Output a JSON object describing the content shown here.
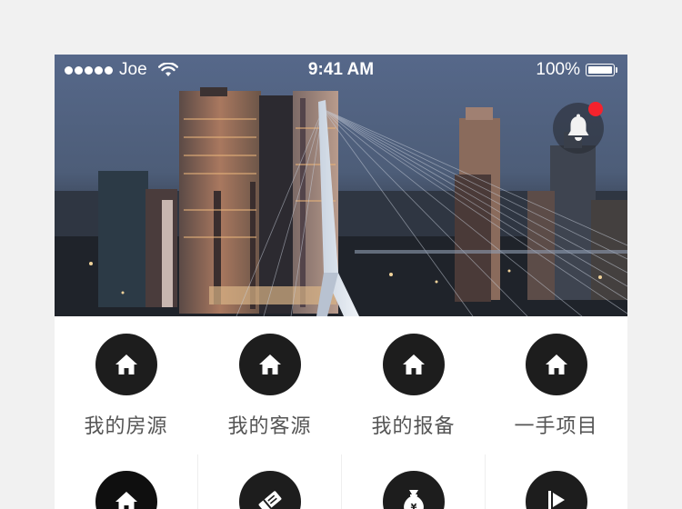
{
  "status_bar": {
    "carrier": "Joe",
    "time": "9:41 AM",
    "battery": "100%"
  },
  "notification": {
    "icon": "bell-icon",
    "has_unread": true,
    "badge_color": "#f5222d"
  },
  "grid": {
    "row1": [
      {
        "label": "我的房源",
        "icon": "home-icon"
      },
      {
        "label": "我的客源",
        "icon": "home-icon"
      },
      {
        "label": "我的报备",
        "icon": "home-icon"
      },
      {
        "label": "一手项目",
        "icon": "home-icon"
      }
    ],
    "row2": [
      {
        "icon": "home-icon"
      },
      {
        "icon": "ticket-icon"
      },
      {
        "icon": "money-bag-icon"
      },
      {
        "icon": "play-flag-icon"
      }
    ]
  },
  "colors": {
    "page_background": "#f1f1f1",
    "icon_circle": "#1d1d1d",
    "label_text": "#555555"
  }
}
